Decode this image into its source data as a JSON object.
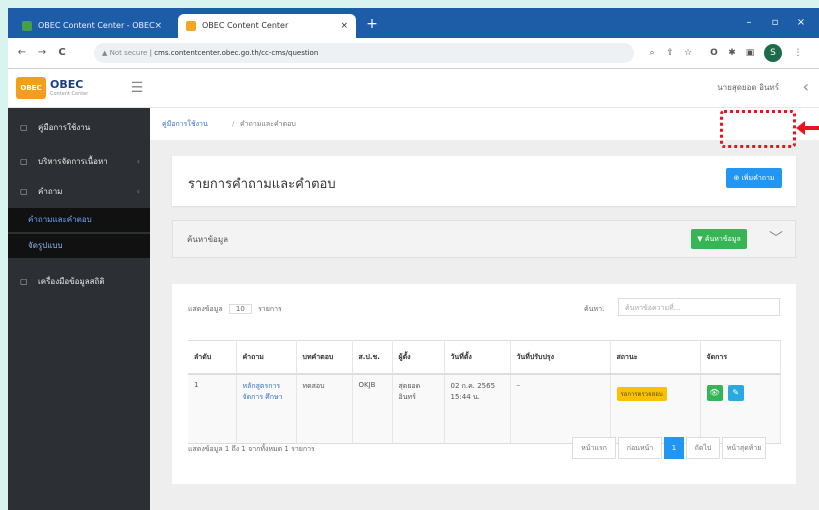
{
  "browser": {
    "tabs": [
      {
        "title": "OBEC Content Center - OBEC",
        "close": "×"
      },
      {
        "title": "OBEC Content Center",
        "close": "×"
      }
    ],
    "new_tab": "+",
    "window_controls": [
      "–",
      "▫",
      "×"
    ],
    "nav": {
      "back": "←",
      "forward": "→",
      "reload": "C"
    },
    "address": {
      "security": "▲ Not secure",
      "url": "cms.contentcenter.obec.go.th/cc-cms/question"
    },
    "toolbar_icons": [
      "⌕",
      "⇪",
      "☆",
      "O",
      "✱",
      "▣"
    ],
    "profile_initial": "S",
    "menu_icon": "⋮"
  },
  "app": {
    "logo_mark": "OBEC",
    "logo_name": "OBEC",
    "logo_sub": "Content Center",
    "hamburger": "☰",
    "username": "นายสุดยอด อินทร์",
    "back_chevron": "‹"
  },
  "sidebar": {
    "items": [
      {
        "icon": "▢",
        "label": "คู่มือการใช้งาน",
        "arrow": ""
      },
      {
        "icon": "▢",
        "label": "บริหารจัดการเนื้อหา",
        "arrow": "‹"
      },
      {
        "icon": "▢",
        "label": "คำถาม",
        "arrow": "‹"
      }
    ],
    "subitems": [
      {
        "label": "คำถามและคำตอบ"
      },
      {
        "label": "จัดรูปแบบ"
      }
    ],
    "last": {
      "icon": "▢",
      "label": "เครื่องมือข้อมูลสถิติ"
    }
  },
  "breadcrumb": {
    "home": "คู่มือการใช้งาน",
    "sep": "/",
    "current": "คำถามและคำตอบ"
  },
  "page": {
    "title": "รายการคำถามและคำตอบ",
    "add_button": "⊕ เพิ่มคำถาม"
  },
  "search_panel": {
    "label": "ค้นหาข้อมูล",
    "button": "▼ ค้นหาข้อมูล",
    "chevron": "﹀"
  },
  "table": {
    "show_prefix": "แสดงข้อมูล",
    "show_value": "10",
    "show_suffix": "รายการ",
    "search_label": "ค้นหา:",
    "search_placeholder": "ค้นหาข้อความที่...",
    "columns": [
      "ลำดับ",
      "คำถาม",
      "บทคำตอบ",
      "ส.ป.ช.",
      "ผู้ตั้ง",
      "วันที่ตั้ง",
      "วันที่ปรับปรุง",
      "สถานะ",
      "จัดการ"
    ],
    "rows": [
      {
        "no": "1",
        "question": "หลักสูตรการจัดการ ศึกษา",
        "answer": "ทดสอบ",
        "area": "OKJB",
        "asker": "สุดยอด อินทร์",
        "created": "02 ก.ค. 2565 15:44 น.",
        "updated": "–",
        "status": "รอการตรวจสอบ",
        "view_icon": "👁",
        "edit_icon": "✎"
      }
    ],
    "footer_info": "แสดงข้อมูล 1 ถึง 1 จากทั้งหมด 1 รายการ",
    "pager": [
      "หน้าแรก",
      "ก่อนหน้า",
      "1",
      "ถัดไป",
      "หน้าสุดท้าย"
    ]
  },
  "colors": {
    "tabstrip": "#1d5da8",
    "sidebar": "#2c2f33",
    "primary": "#2196f3",
    "success": "#35b556",
    "warning": "#f9c200",
    "highlight": "#e8141e"
  }
}
